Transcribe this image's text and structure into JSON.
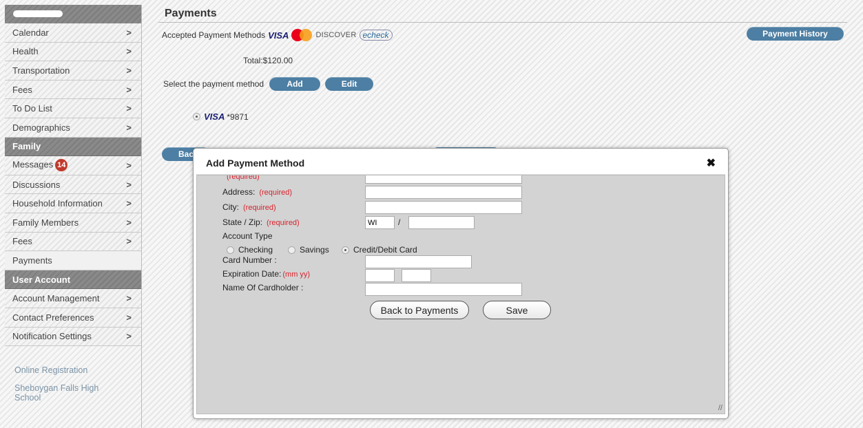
{
  "sidebar": {
    "items_top": [
      {
        "label": "Calendar"
      },
      {
        "label": "Health"
      },
      {
        "label": "Transportation"
      },
      {
        "label": "Fees"
      },
      {
        "label": "To Do List"
      },
      {
        "label": "Demographics"
      }
    ],
    "family_header": "Family",
    "messages_label": "Messages",
    "messages_badge": "14",
    "items_family": [
      {
        "label": "Discussions"
      },
      {
        "label": "Household Information"
      },
      {
        "label": "Family Members"
      },
      {
        "label": "Fees"
      }
    ],
    "payments_label": "Payments",
    "user_account_header": "User Account",
    "items_account": [
      {
        "label": "Account Management"
      },
      {
        "label": "Contact Preferences"
      },
      {
        "label": "Notification Settings"
      }
    ],
    "links": [
      "Online Registration",
      "Sheboygan Falls High School"
    ],
    "chevron": ">"
  },
  "main": {
    "title": "Payments",
    "accepted_label": "Accepted Payment Methods",
    "visa_label": "VISA",
    "discover_label": "DISCOVER",
    "echeck_label": "echeck",
    "history_button": "Payment History",
    "total": "Total:$120.00",
    "select_label": "Select the payment method",
    "add_button": "Add",
    "edit_button": "Edit",
    "saved_card_brand": "VISA",
    "saved_card_suffix": "*9871",
    "back_button_partial": "Bac"
  },
  "modal": {
    "title": "Add Payment Method",
    "close_glyph": "✖",
    "address_label": "Address:",
    "city_label": "City:",
    "state_zip_label": "State / Zip:",
    "required_text": "(required)",
    "state_value": "WI",
    "zip_separator": "/",
    "account_type_label": "Account Type",
    "account_options": [
      "Checking",
      "Savings",
      "Credit/Debit Card"
    ],
    "card_number_label": "Card Number :",
    "expiration_label": "Expiration Date:",
    "expiration_hint": "(mm yy)",
    "cardholder_label": "Name Of Cardholder :",
    "back_button": "Back to Payments",
    "save_button": "Save",
    "resize_glyph": "//"
  },
  "colors": {
    "pill_blue": "#4d7ea3",
    "required_red": "#d9232d",
    "badge_red": "#c0392b"
  }
}
